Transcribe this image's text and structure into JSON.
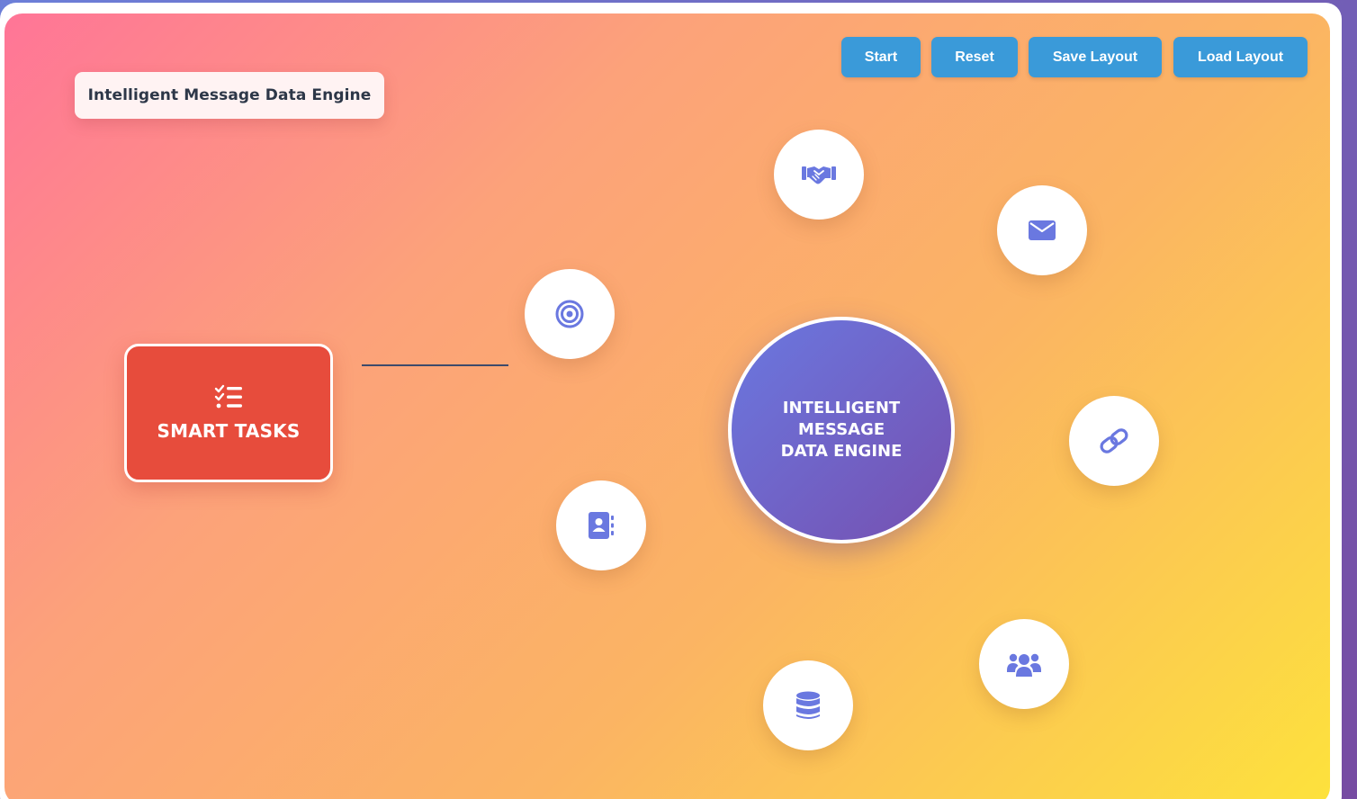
{
  "app": {
    "title": "Intelligent Message Data Engine"
  },
  "toolbar": {
    "start_label": "Start",
    "reset_label": "Reset",
    "save_label": "Save Layout",
    "load_label": "Load Layout"
  },
  "task_node": {
    "label": "SMART TASKS",
    "icon": "task-list-icon",
    "color": "#e74c3c"
  },
  "center_node": {
    "label": "INTELLIGENT MESSAGE DATA ENGINE",
    "gradient": [
      "#6a78e0",
      "#7650b0"
    ]
  },
  "satellites": [
    {
      "icon": "handshake-icon"
    },
    {
      "icon": "envelope-icon"
    },
    {
      "icon": "target-icon"
    },
    {
      "icon": "link-icon"
    },
    {
      "icon": "contact-book-icon"
    },
    {
      "icon": "users-icon"
    },
    {
      "icon": "database-icon"
    }
  ],
  "colors": {
    "button": "#3a9ad9",
    "icon": "#6a78e0",
    "background_gradient": [
      "#ff7597",
      "#fca27a",
      "#fbb463",
      "#fde23c"
    ]
  }
}
